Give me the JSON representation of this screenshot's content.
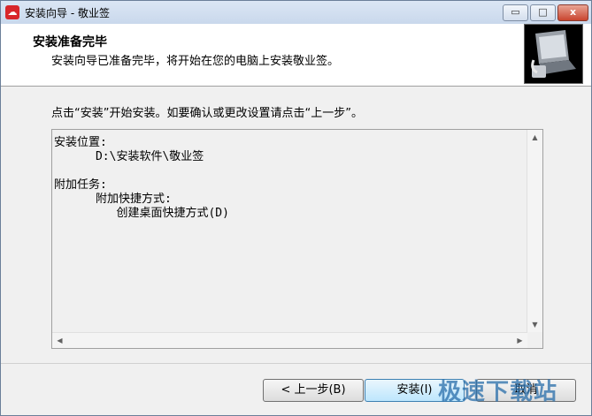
{
  "window": {
    "title": "安装向导 - 敬业签",
    "icon": "app-logo-icon",
    "controls": {
      "minimize": "▭",
      "maximize": "□",
      "close": "x"
    }
  },
  "header": {
    "title": "安装准备完毕",
    "subtitle": "安装向导已准备完毕，将开始在您的电脑上安装敬业签。",
    "image": "computer-installer-icon"
  },
  "instruction": "点击“安装”开始安装。如要确认或更改设置请点击“上一步”。",
  "memo": {
    "lines": [
      "安装位置:",
      "      D:\\安装软件\\敬业签",
      "",
      "附加任务:",
      "      附加快捷方式:",
      "         创建桌面快捷方式(D)"
    ]
  },
  "buttons": {
    "back": "< 上一步(B)",
    "install": "安装(I)",
    "cancel": "取消"
  },
  "watermark": "极速下载站",
  "colors": {
    "title_bar": "#c9d8ec",
    "accent": "#3c7fb1",
    "close": "#c9452f"
  }
}
